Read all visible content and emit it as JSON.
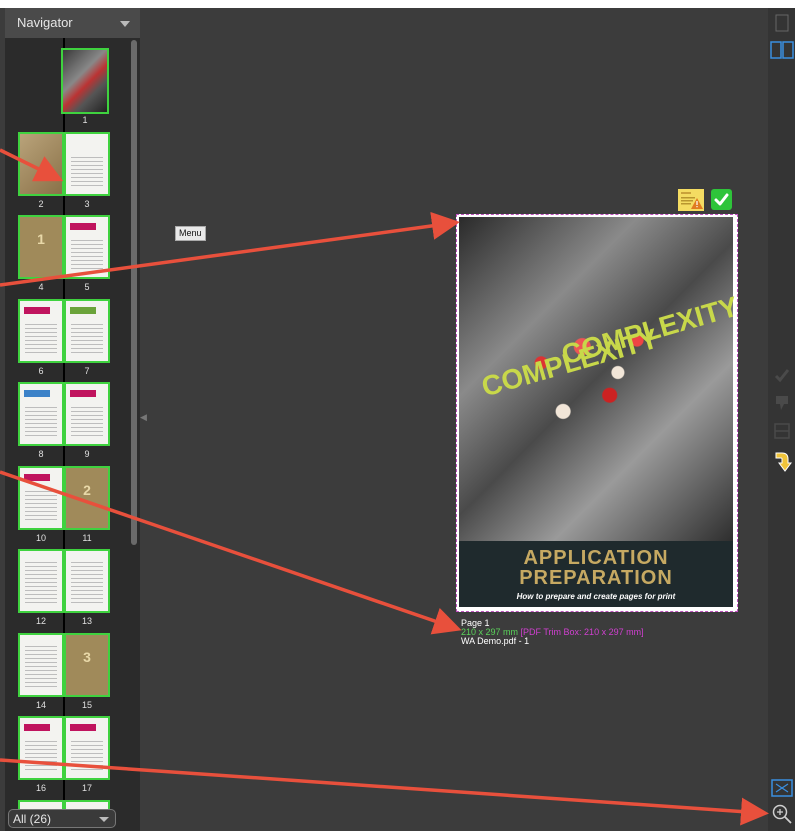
{
  "navigator": {
    "title": "Navigator",
    "filter_value": "All (26)",
    "pages": [
      {
        "label": "1"
      },
      {
        "label": "2"
      },
      {
        "label": "3"
      },
      {
        "label": "4"
      },
      {
        "label": "5"
      },
      {
        "label": "6"
      },
      {
        "label": "7"
      },
      {
        "label": "8"
      },
      {
        "label": "9"
      },
      {
        "label": "10"
      },
      {
        "label": "11"
      },
      {
        "label": "12"
      },
      {
        "label": "13"
      },
      {
        "label": "14"
      },
      {
        "label": "15"
      },
      {
        "label": "16"
      },
      {
        "label": "17"
      }
    ],
    "gold_numbers": {
      "p4": "1",
      "p11": "2",
      "p15": "3"
    }
  },
  "viewer": {
    "menu_label": "Menu",
    "cover": {
      "word_left": "COMPLEXITY",
      "word_right": "COMPLEXITY",
      "title_line1": "APPLICATION",
      "title_line2": "PREPARATION",
      "subtitle": "How to prepare and create pages for print"
    },
    "info": {
      "page": "Page 1",
      "size": "210 x 297 mm",
      "trim": "[PDF Trim Box: 210 x 297 mm]",
      "file": "WA Demo.pdf - 1"
    }
  },
  "colors": {
    "thumb_border": "#3fd23f",
    "size_text": "#5ad25a",
    "trim_text": "#d040d0",
    "annotation_arrow": "#e8503c",
    "toolbar_accent": "#3a8fe0"
  },
  "toolbar": {
    "icons": [
      "single-page-icon",
      "spread-view-icon",
      "approve-icon",
      "reject-icon",
      "compare-icon",
      "next-unreviewed-icon",
      "fit-page-icon",
      "zoom-icon"
    ]
  }
}
